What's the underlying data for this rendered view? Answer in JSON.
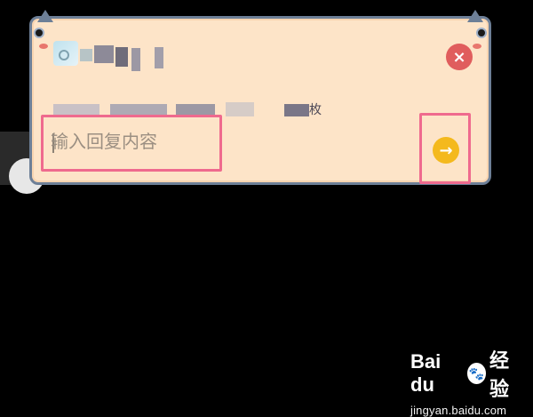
{
  "dialog": {
    "input": {
      "placeholder": "输入回复内容"
    },
    "message_suffix": "枚",
    "close_label": "×",
    "send_label": "→"
  },
  "watermark": {
    "brand": "Bai du",
    "service": "经验",
    "site": "jingyan.baidu.com"
  }
}
